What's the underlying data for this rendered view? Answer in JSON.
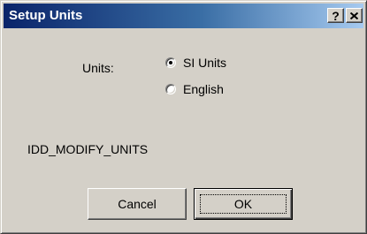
{
  "window": {
    "title": "Setup Units",
    "help_glyph": "?",
    "close_icon": "close-x-icon"
  },
  "form": {
    "units_label": "Units:",
    "options": [
      {
        "label": "SI Units",
        "selected": true
      },
      {
        "label": "English",
        "selected": false
      }
    ],
    "static_id": "IDD_MODIFY_UNITS"
  },
  "buttons": {
    "cancel_label": "Cancel",
    "ok_label": "OK"
  },
  "colors": {
    "face": "#d4d0c8",
    "title_start": "#0a246a",
    "title_end": "#a6caf0"
  }
}
